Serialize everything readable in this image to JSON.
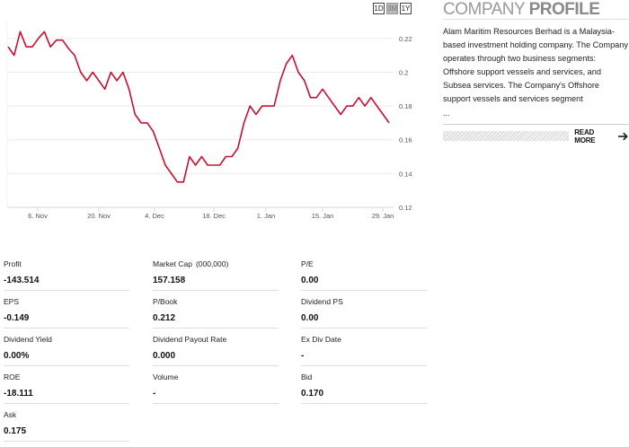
{
  "range_buttons": [
    {
      "label": "1D",
      "active": false
    },
    {
      "label": "3M",
      "active": true
    },
    {
      "label": "1Y",
      "active": false
    }
  ],
  "chart_data": {
    "type": "line",
    "x_tick_labels": [
      "6. Nov",
      "20. Nov",
      "4. Dec",
      "18. Dec",
      "1. Jan",
      "15. Jan",
      "29. Jan"
    ],
    "y_ticks": [
      0.12,
      0.14,
      0.16,
      0.18,
      0.2,
      0.22
    ],
    "y_tick_labels": [
      "0.12",
      "0.14",
      "0.16",
      "0.18",
      "0.2",
      "0.22"
    ],
    "ylim": [
      0.12,
      0.23
    ],
    "line_color": "#c8102e",
    "grid": "horizontal",
    "series": [
      {
        "values": [
          0.215,
          0.21,
          0.224,
          0.215,
          0.215,
          0.22,
          0.224,
          0.215,
          0.219,
          0.219,
          0.214,
          0.21,
          0.2,
          0.195,
          0.2,
          0.195,
          0.19,
          0.2,
          0.195,
          0.2,
          0.19,
          0.175,
          0.17,
          0.17,
          0.165,
          0.155,
          0.145,
          0.14,
          0.135,
          0.135,
          0.15,
          0.145,
          0.15,
          0.145,
          0.145,
          0.145,
          0.15,
          0.15,
          0.155,
          0.17,
          0.18,
          0.175,
          0.18,
          0.18,
          0.18,
          0.195,
          0.205,
          0.21,
          0.2,
          0.195,
          0.185,
          0.185,
          0.19,
          0.185,
          0.18,
          0.175,
          0.18,
          0.18,
          0.185,
          0.18,
          0.185,
          0.18,
          0.175,
          0.17
        ]
      }
    ]
  },
  "profile": {
    "title_light": "COMPANY",
    "title_bold": "PROFILE",
    "description": "Alam Maritim Resources Berhad is a Malaysia-based investment holding company. The Company operates through two business segments: Offshore support vessels and services, and Subsea services. The Company's Offshore support vessels and services segment",
    "ellipsis": "...",
    "read_more": "READ MORE",
    "arrow_icon": "arrow-right-icon"
  },
  "stats": [
    {
      "label": "Profit",
      "unit": "",
      "value": "-143.514"
    },
    {
      "label": "Market Cap",
      "unit": "(000,000)",
      "value": "157.158"
    },
    {
      "label": "P/E",
      "unit": "",
      "value": "0.00"
    },
    {
      "label": "EPS",
      "unit": "",
      "value": "-0.149"
    },
    {
      "label": "P/Book",
      "unit": "",
      "value": "0.212"
    },
    {
      "label": "Dividend PS",
      "unit": "",
      "value": "0.00"
    },
    {
      "label": "Dividend Yield",
      "unit": "",
      "value": "0.00%"
    },
    {
      "label": "Dividend Payout Rate",
      "unit": "",
      "value": "0.000"
    },
    {
      "label": "Ex Div Date",
      "unit": "",
      "value": "-"
    },
    {
      "label": "ROE",
      "unit": "",
      "value": "-18.111"
    },
    {
      "label": "Volume",
      "unit": "",
      "value": "-"
    },
    {
      "label": "Bid",
      "unit": "",
      "value": "0.170"
    },
    {
      "label": "Ask",
      "unit": "",
      "value": "0.175"
    }
  ]
}
